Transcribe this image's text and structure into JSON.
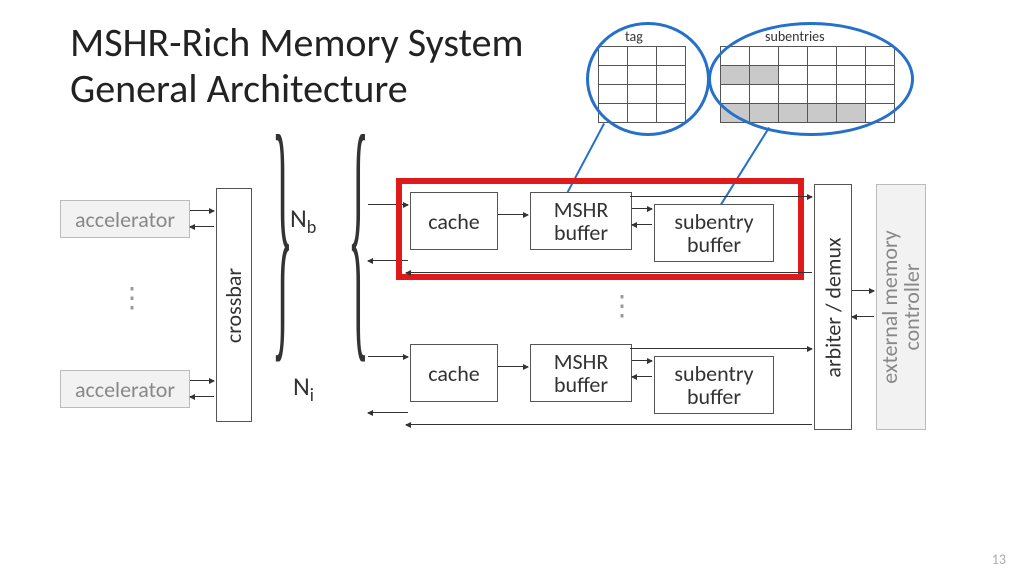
{
  "title_line1": "MSHR-Rich Memory System",
  "title_line2": "General Architecture",
  "page_number": "13",
  "labels": {
    "accelerator": "accelerator",
    "crossbar": "crossbar",
    "Nb": "N",
    "Nb_sub": "b",
    "Ni": "N",
    "Ni_sub": "i",
    "cache": "cache",
    "mshr": "MSHR",
    "mshr2": "buffer",
    "subentry": "subentry",
    "subentry2": "buffer",
    "arbiter": "arbiter / demux",
    "ext1": "external memory",
    "ext2": "controller",
    "tag": "tag",
    "subentries": "subentries"
  },
  "dots": "⋮",
  "diagram": {
    "components_left_to_right": [
      "accelerator (×Ni)",
      "crossbar",
      "Nb banks of {cache → MSHR buffer → subentry buffer}",
      "arbiter / demux",
      "external memory controller"
    ],
    "callouts": [
      "tag table",
      "subentries table"
    ],
    "highlight": "red box around one {cache, MSHR buffer, subentry buffer} bank",
    "parameters": [
      "N_b = number of banks",
      "N_i = number of accelerators"
    ]
  }
}
